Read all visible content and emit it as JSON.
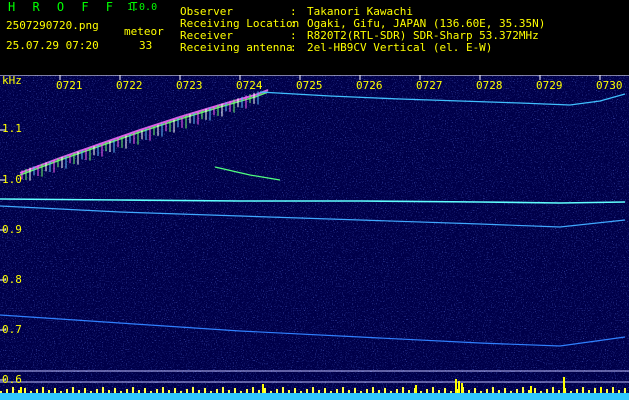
{
  "header": {
    "app_title": "H R O F F T",
    "version": "1.0.0",
    "filename": "2507290720.png",
    "datetime": "25.07.29 07:20",
    "meteor_label": "meteor",
    "meteor_count": "33"
  },
  "meta": [
    {
      "key": "Observer",
      "value": "Takanori Kawachi"
    },
    {
      "key": "Receiving Location",
      "value": "Ogaki, Gifu, JAPAN (136.60E, 35.35N)"
    },
    {
      "key": "Receiver",
      "value": "R820T2(RTL-SDR) SDR-Sharp 53.372MHz"
    },
    {
      "key": "Receiving antenna",
      "value": "2el-HB9CV Vertical (el. E-W)"
    }
  ],
  "axis": {
    "unit": "kHz",
    "y_ticks": [
      "1.1",
      "1.0",
      "0.9",
      "0.8",
      "0.7",
      "0.6"
    ],
    "x_ticks": [
      "0721",
      "0722",
      "0723",
      "0724",
      "0725",
      "0726",
      "0727",
      "0728",
      "0729",
      "0730"
    ]
  },
  "colors": {
    "background": "#00004a",
    "label_yellow": "#ffff00",
    "title_green": "#00ff00",
    "trace_cyan": "#40ffff"
  }
}
